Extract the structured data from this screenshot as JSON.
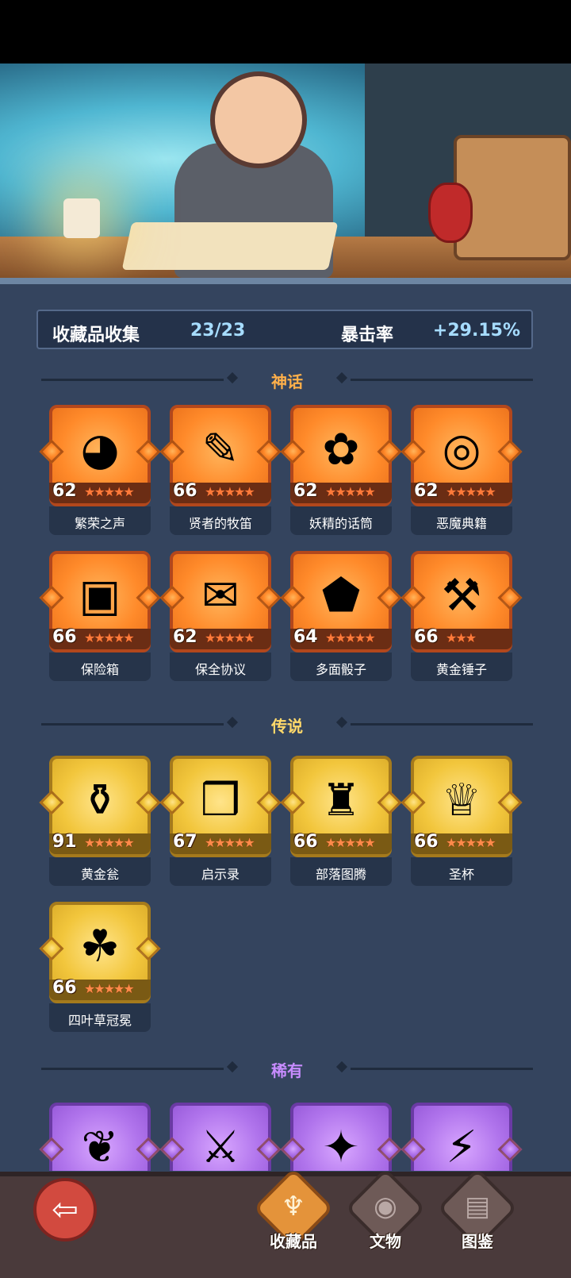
{
  "collection": {
    "label": "收藏品收集",
    "count": "23/23",
    "crit_label": "暴击率",
    "crit_value": "+29.15%"
  },
  "sections": {
    "mythic": {
      "title": "神话",
      "color": "#ffb04a"
    },
    "legend": {
      "title": "传说",
      "color": "#ffd86a"
    },
    "rare": {
      "title": "稀有",
      "color": "#c88cff"
    }
  },
  "mythic_items": [
    {
      "name": "繁荣之声",
      "level": "62",
      "stars": "★★★★★",
      "icon": "song-orb-icon"
    },
    {
      "name": "贤者的牧笛",
      "level": "66",
      "stars": "★★★★★",
      "icon": "flute-icon"
    },
    {
      "name": "妖精的话筒",
      "level": "62",
      "stars": "★★★★★",
      "icon": "fairy-microphone-icon"
    },
    {
      "name": "恶魔典籍",
      "level": "62",
      "stars": "★★★★★",
      "icon": "demon-book-icon"
    },
    {
      "name": "保险箱",
      "level": "66",
      "stars": "★★★★★",
      "icon": "treasure-chest-icon"
    },
    {
      "name": "保全协议",
      "level": "62",
      "stars": "★★★★★",
      "icon": "scroll-contract-icon"
    },
    {
      "name": "多面骰子",
      "level": "64",
      "stars": "★★★★★",
      "icon": "dice-icon"
    },
    {
      "name": "黄金锤子",
      "level": "66",
      "stars": "★★★",
      "icon": "gold-hammer-icon"
    }
  ],
  "legend_items": [
    {
      "name": "黄金瓮",
      "level": "91",
      "stars": "★★★★★",
      "icon": "gold-urn-icon"
    },
    {
      "name": "启示录",
      "level": "67",
      "stars": "★★★★★",
      "icon": "open-book-icon"
    },
    {
      "name": "部落图腾",
      "level": "66",
      "stars": "★★★★★",
      "icon": "totem-icon"
    },
    {
      "name": "圣杯",
      "level": "66",
      "stars": "★★★★★",
      "icon": "grail-icon"
    },
    {
      "name": "四叶草冠冕",
      "level": "66",
      "stars": "★★★★★",
      "icon": "clover-crown-icon"
    }
  ],
  "rare_items_icons": [
    "vine-icon",
    "ice-sword-icon",
    "fire-feather-icon",
    "lightning-card-icon"
  ],
  "nav": {
    "back_icon": "back-arrow-icon",
    "tabs": [
      {
        "label": "收藏品",
        "icon": "harp-icon",
        "active": true
      },
      {
        "label": "文物",
        "icon": "eye-icon",
        "active": false
      },
      {
        "label": "图鉴",
        "icon": "book-icon",
        "active": false
      }
    ]
  }
}
